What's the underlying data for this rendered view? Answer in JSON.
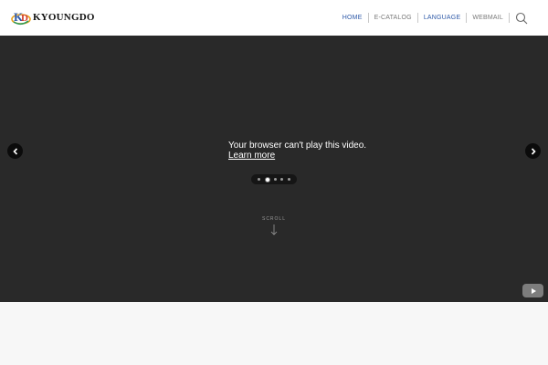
{
  "brand": {
    "name": "KYOUNGDO"
  },
  "nav": {
    "items": [
      {
        "label": "HOME",
        "active": true
      },
      {
        "label": "E-CATALOG",
        "active": false
      },
      {
        "label": "LANGUAGE",
        "active": true
      },
      {
        "label": "WEBMAIL",
        "active": false
      }
    ],
    "search_icon": "search-icon"
  },
  "video": {
    "message": "Your browser can't play this video.",
    "link_text": "Learn more",
    "slides_total": 5,
    "slide_active": 2,
    "prev_icon": "chevron-left-icon",
    "next_icon": "chevron-right-icon",
    "youtube_icon": "youtube-play-icon"
  },
  "scroll": {
    "label": "SCROLL",
    "icon": "arrow-down-icon"
  },
  "colors": {
    "accent": "#2f5aa8",
    "video_bg": "#292929",
    "header_bg": "#ffffff"
  }
}
